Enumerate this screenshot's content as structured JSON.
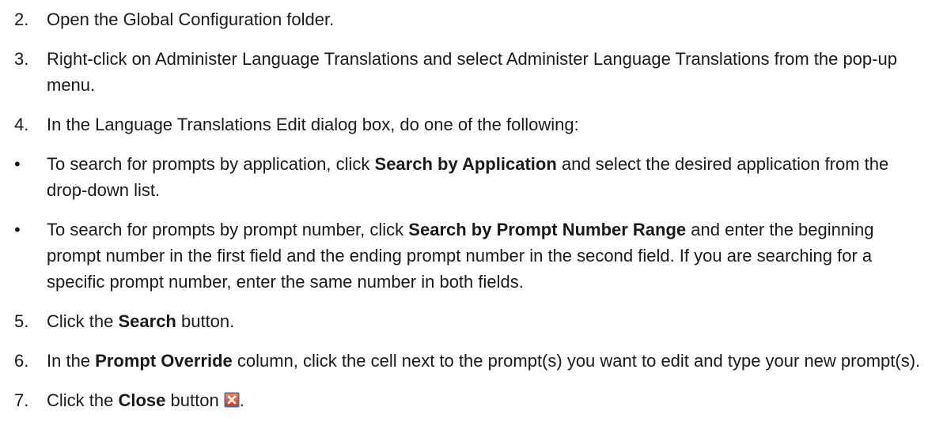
{
  "steps": [
    {
      "marker": "2.",
      "text": "Open the Global Configuration folder."
    },
    {
      "marker": "3.",
      "text": "Right-click on Administer Language Translations and select Administer Language Translations from the pop-up menu."
    },
    {
      "marker": "4.",
      "text": "In the Language Translations Edit dialog box, do one of the following:"
    },
    {
      "marker": "•",
      "before": "To search for prompts by application, click ",
      "bold": "Search by Application",
      "after": " and select the desired application from the drop-down list."
    },
    {
      "marker": "•",
      "before": "To search for prompts by prompt number, click ",
      "bold": "Search by Prompt Number Range",
      "after": " and enter the beginning prompt number in the first field and the ending prompt number in the second field. If you are searching for a specific prompt number, enter the same number in both fields."
    },
    {
      "marker": "5.",
      "before": "Click the ",
      "bold": "Search",
      "after": " button."
    },
    {
      "marker": "6.",
      "before": "In the ",
      "bold": "Prompt Override",
      "after": " column, click the cell next to the prompt(s) you want to edit and type your new prompt(s)."
    },
    {
      "marker": "7.",
      "before": "Click the ",
      "bold": "Close",
      "after": " button",
      "trailing": ".",
      "icon": "close-icon",
      "icon_colors": {
        "frame": "#3a6fb0",
        "fill_top": "#f28a5a",
        "fill_bottom": "#d9361a",
        "x": "#ffffff"
      }
    }
  ]
}
